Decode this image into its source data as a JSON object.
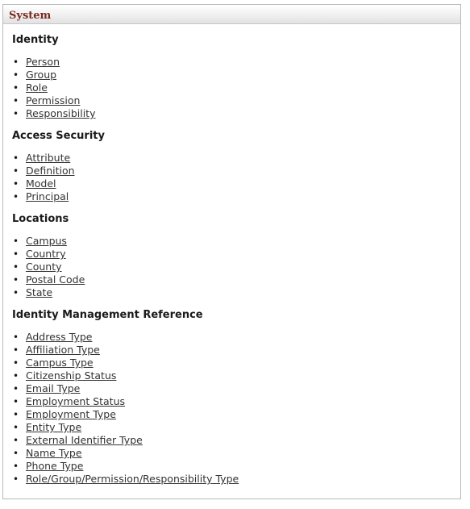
{
  "panel": {
    "title": "System",
    "sections": [
      {
        "heading": "Identity",
        "links": [
          "Person",
          "Group",
          "Role",
          "Permission",
          "Responsibility"
        ]
      },
      {
        "heading": "Access Security",
        "links": [
          "Attribute",
          "Definition",
          "Model",
          "Principal"
        ]
      },
      {
        "heading": "Locations",
        "links": [
          "Campus",
          "Country",
          "County",
          "Postal Code",
          "State"
        ]
      },
      {
        "heading": "Identity Management Reference",
        "links": [
          "Address Type",
          "Affiliation Type",
          "Campus Type",
          "Citizenship Status",
          "Email Type",
          "Employment Status",
          "Employment Type",
          "Entity Type",
          "External Identifier Type",
          "Name Type",
          "Phone Type",
          "Role/Group/Permission/Responsibility Type"
        ]
      }
    ]
  }
}
